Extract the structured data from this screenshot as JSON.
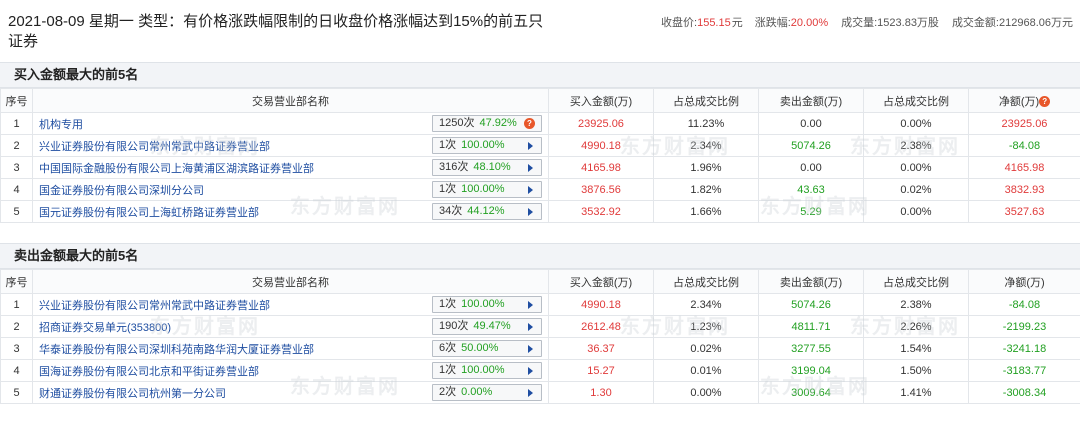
{
  "header": {
    "title": "2021-08-09 星期一 类型：有价格涨跌幅限制的日收盘价格涨幅达到15%的前五只证券",
    "stats": [
      {
        "label": "收盘价:",
        "value": "155.15",
        "unit": "元"
      },
      {
        "label": "涨跌幅:",
        "value": "20.00%",
        "unit": ""
      },
      {
        "label": "成交量:",
        "value": "1523.83万股",
        "unit": ""
      },
      {
        "label": "成交金额:",
        "value": "212968.06万元",
        "unit": ""
      }
    ]
  },
  "buy": {
    "title": "买入金额最大的前5名",
    "columns": [
      "序号",
      "交易营业部名称",
      "买入金额(万)",
      "占总成交比例",
      "卖出金额(万)",
      "占总成交比例",
      "净额(万)"
    ],
    "rows": [
      {
        "idx": "1",
        "name": "机构专用",
        "cnt": "1250次",
        "pct": "47.92%",
        "buy": "23925.06",
        "buyPct": "11.23%",
        "sell": "0.00",
        "sellPct": "0.00%",
        "net": "23925.06",
        "icon": "question"
      },
      {
        "idx": "2",
        "name": "兴业证券股份有限公司常州常武中路证券营业部",
        "cnt": "1次",
        "pct": "100.00%",
        "buy": "4990.18",
        "buyPct": "2.34%",
        "sell": "5074.26",
        "sellPct": "2.38%",
        "net": "-84.08",
        "icon": "arrow"
      },
      {
        "idx": "3",
        "name": "中国国际金融股份有限公司上海黄浦区湖滨路证券营业部",
        "cnt": "316次",
        "pct": "48.10%",
        "buy": "4165.98",
        "buyPct": "1.96%",
        "sell": "0.00",
        "sellPct": "0.00%",
        "net": "4165.98",
        "icon": "arrow"
      },
      {
        "idx": "4",
        "name": "国金证券股份有限公司深圳分公司",
        "cnt": "1次",
        "pct": "100.00%",
        "buy": "3876.56",
        "buyPct": "1.82%",
        "sell": "43.63",
        "sellPct": "0.02%",
        "net": "3832.93",
        "icon": "arrow"
      },
      {
        "idx": "5",
        "name": "国元证券股份有限公司上海虹桥路证券营业部",
        "cnt": "34次",
        "pct": "44.12%",
        "buy": "3532.92",
        "buyPct": "1.66%",
        "sell": "5.29",
        "sellPct": "0.00%",
        "net": "3527.63",
        "icon": "arrow"
      }
    ]
  },
  "sell": {
    "title": "卖出金额最大的前5名",
    "columns": [
      "序号",
      "交易营业部名称",
      "买入金额(万)",
      "占总成交比例",
      "卖出金额(万)",
      "占总成交比例",
      "净额(万)"
    ],
    "rows": [
      {
        "idx": "1",
        "name": "兴业证券股份有限公司常州常武中路证券营业部",
        "cnt": "1次",
        "pct": "100.00%",
        "buy": "4990.18",
        "buyPct": "2.34%",
        "sell": "5074.26",
        "sellPct": "2.38%",
        "net": "-84.08",
        "icon": "arrow"
      },
      {
        "idx": "2",
        "name": "招商证券交易单元(353800)",
        "cnt": "190次",
        "pct": "49.47%",
        "buy": "2612.48",
        "buyPct": "1.23%",
        "sell": "4811.71",
        "sellPct": "2.26%",
        "net": "-2199.23",
        "icon": "arrow"
      },
      {
        "idx": "3",
        "name": "华泰证券股份有限公司深圳科苑南路华润大厦证券营业部",
        "cnt": "6次",
        "pct": "50.00%",
        "buy": "36.37",
        "buyPct": "0.02%",
        "sell": "3277.55",
        "sellPct": "1.54%",
        "net": "-3241.18",
        "icon": "arrow"
      },
      {
        "idx": "4",
        "name": "国海证券股份有限公司北京和平街证券营业部",
        "cnt": "1次",
        "pct": "100.00%",
        "buy": "15.27",
        "buyPct": "0.01%",
        "sell": "3199.04",
        "sellPct": "1.50%",
        "net": "-3183.77",
        "icon": "arrow"
      },
      {
        "idx": "5",
        "name": "财通证券股份有限公司杭州第一分公司",
        "cnt": "2次",
        "pct": "0.00%",
        "buy": "1.30",
        "buyPct": "0.00%",
        "sell": "3009.64",
        "sellPct": "1.41%",
        "net": "-3008.34",
        "icon": "arrow"
      }
    ]
  },
  "watermark": "东方财富网",
  "colors": {
    "up": "#e03a3a",
    "down": "#22a022",
    "link": "#1f4ea1"
  }
}
